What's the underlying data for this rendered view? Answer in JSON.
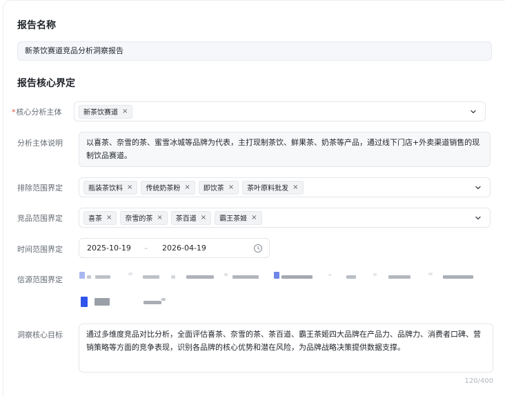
{
  "report_name": {
    "title": "报告名称",
    "value": "新茶饮赛道竞品分析洞察报告"
  },
  "core_definition": {
    "title": "报告核心界定",
    "subject": {
      "required_mark": "*",
      "label": "核心分析主体",
      "tags": [
        "新茶饮赛道"
      ]
    },
    "subject_desc": {
      "label": "分析主体说明",
      "value": "以喜茶、奈雪的茶、蜜雪冰城等品牌为代表，主打现制茶饮、鲜果茶、奶茶等产品，通过线下门店+外卖渠道销售的现制饮品赛道。"
    },
    "exclude": {
      "label": "排除范围界定",
      "tags": [
        "瓶装茶饮料",
        "传统奶茶粉",
        "即饮茶",
        "茶叶原料批发"
      ]
    },
    "competitors": {
      "label": "竞品范围界定",
      "tags": [
        "喜茶",
        "奈雪的茶",
        "茶百道",
        "霸王茶姬"
      ]
    },
    "time_range": {
      "label": "时间范围界定",
      "start": "2025-10-19",
      "separator": "–",
      "end": "2026-04-19"
    },
    "sources": {
      "label": "信源范围界定"
    },
    "goal": {
      "label": "洞察核心目标",
      "value": "通过多维度竞品对比分析，全面评估喜茶、奈雪的茶、茶百道、霸王茶姬四大品牌在产品力、品牌力、消费者口碑、营销策略等方面的竞争表现，识别各品牌的核心优势和潜在风险，为品牌战略决策提供数据支撑。",
      "counter": "120/400"
    }
  },
  "tag_remove_glyph": "×",
  "icons": {
    "dropdown": "chevron-down-icon",
    "clock": "clock-icon",
    "remove": "close-icon"
  },
  "colors": {
    "required": "#e84a3c",
    "source_accent": "#2f54eb"
  }
}
